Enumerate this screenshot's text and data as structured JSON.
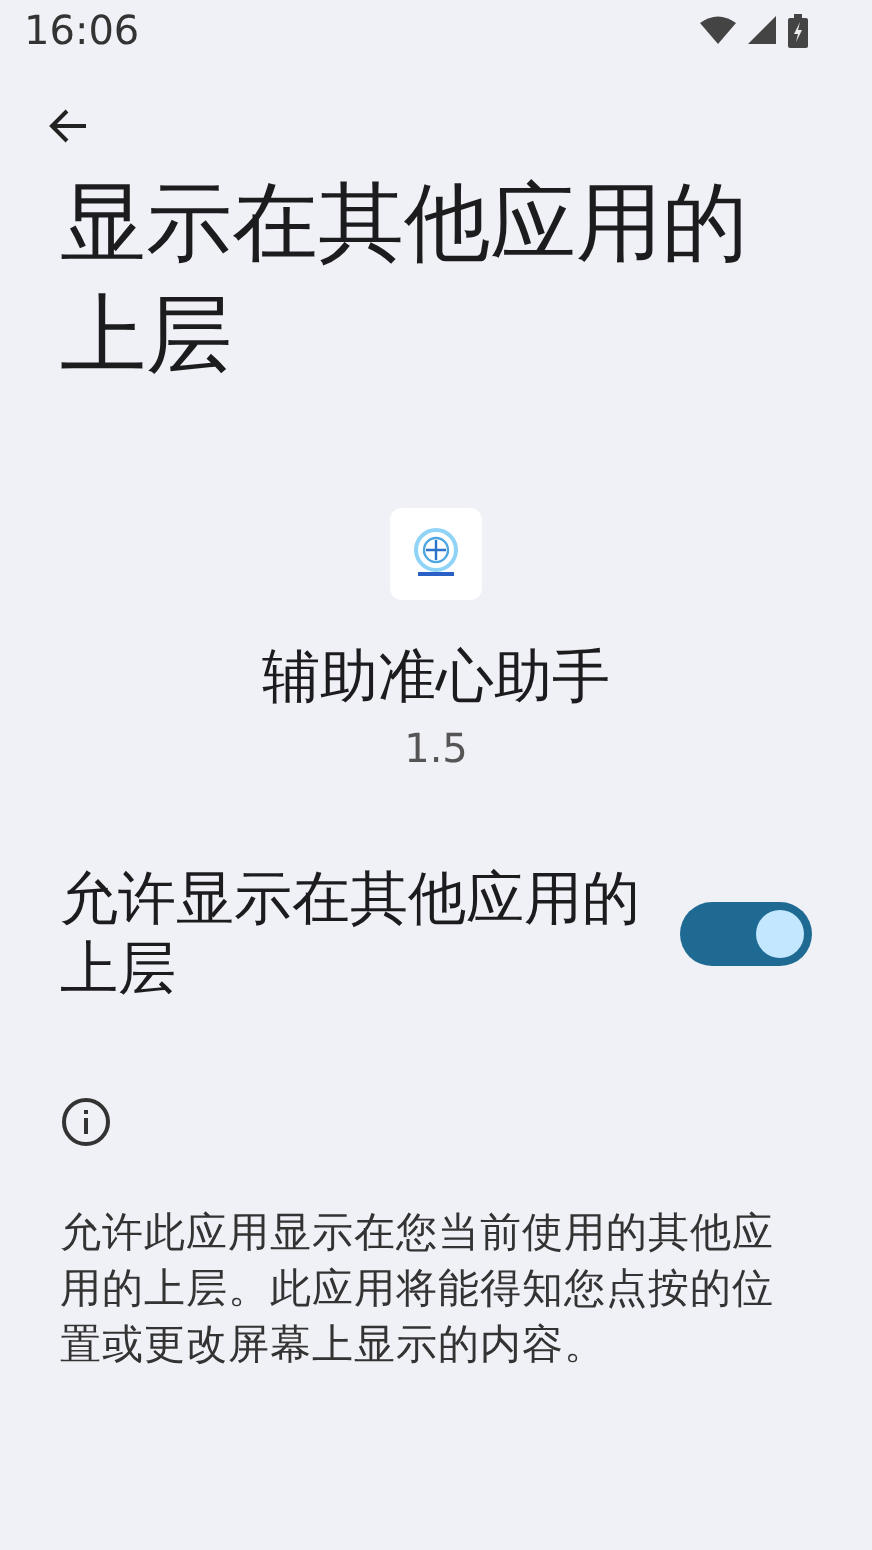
{
  "status_bar": {
    "time": "16:06"
  },
  "page": {
    "title": "显示在其他应用的上层"
  },
  "app": {
    "name": "辅助准心助手",
    "version": "1.5"
  },
  "permission": {
    "label": "允许显示在其他应用的上层",
    "on": true
  },
  "description": "允许此应用显示在您当前使用的其他应用的上层。此应用将能得知您点按的位置或更改屏幕上显示的内容。"
}
